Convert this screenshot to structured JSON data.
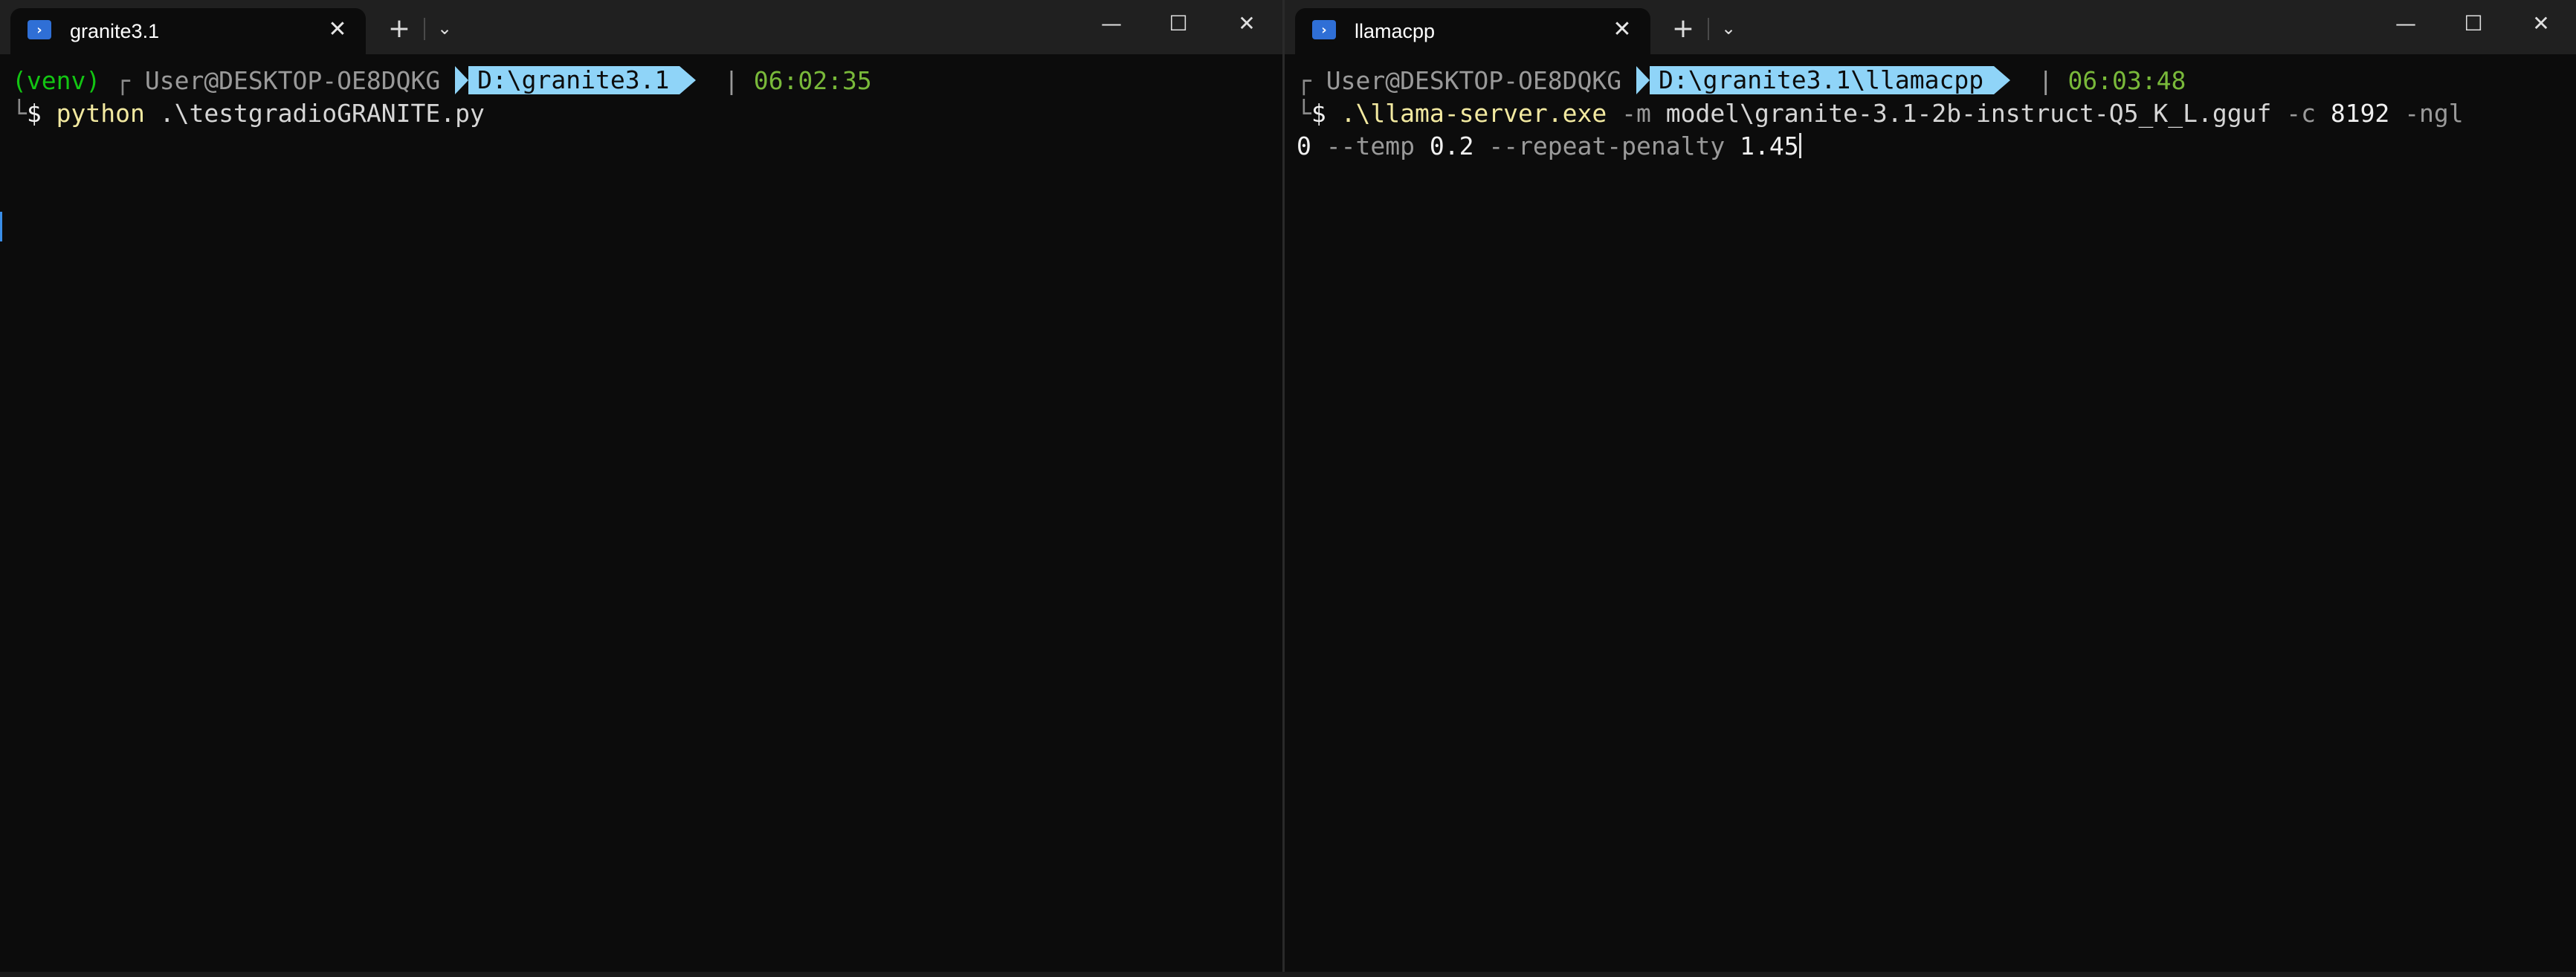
{
  "left": {
    "tab_title": "granite3.1",
    "tab_icon": "powershell-icon",
    "prompt": {
      "venv": "(venv)",
      "user": "User@DESKTOP-OE8DQKG",
      "path": "D:\\granite3.1",
      "separator": "|",
      "time": "06:02:35"
    },
    "command": {
      "program": "python",
      "args": ".\\testgradioGRANITE.py"
    }
  },
  "right": {
    "tab_title": "llamacpp",
    "tab_icon": "powershell-icon",
    "prompt": {
      "user": "User@DESKTOP-OE8DQKG",
      "path": "D:\\granite3.1\\llamacpp",
      "separator": "|",
      "time": "06:03:48"
    },
    "command": {
      "program": ".\\llama-server.exe",
      "flag_m": "-m",
      "model": "model\\granite-3.1-2b-instruct-Q5_K_L.gguf",
      "flag_c": "-c",
      "ctx": "8192",
      "flag_ngl": "-ngl",
      "ngl": "0",
      "flag_temp": "--temp",
      "temp": "0.2",
      "flag_repeat": "--repeat-penalty",
      "repeat": "1.45"
    }
  },
  "prompt_char": "$",
  "prompt_corner_top": "┌",
  "prompt_corner_bottom": "└",
  "controls": {
    "close_glyph": "✕",
    "new_tab_glyph": "+",
    "dropdown_glyph": "⌄",
    "minimize_glyph": "—",
    "maximize_glyph": "☐"
  },
  "colors": {
    "background": "#0c0c0c",
    "titlebar": "#202020",
    "path_segment": "#8fd4f8",
    "venv": "#13c513",
    "time": "#79b93a"
  }
}
